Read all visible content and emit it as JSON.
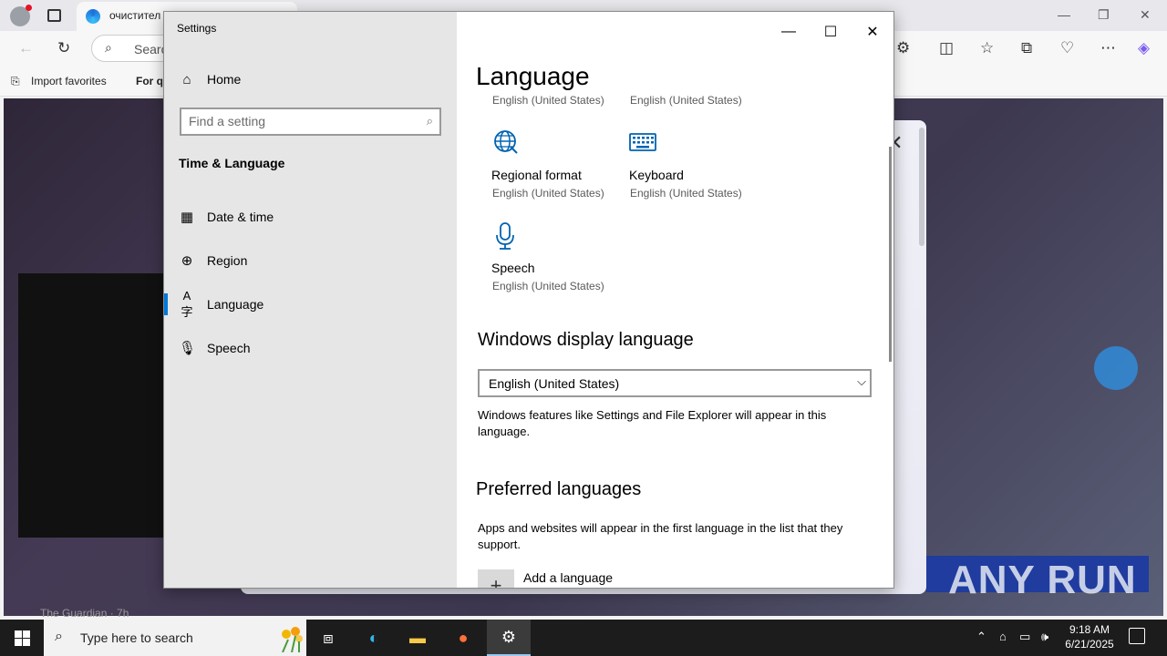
{
  "browser": {
    "tab_title": "очистител",
    "address_placeholder": "Searc",
    "favorites": [
      "Import favorites",
      "For qu"
    ],
    "page_footer": "The Guardian · 7h"
  },
  "settings": {
    "window_title": "Settings",
    "nav": {
      "home": "Home",
      "search_placeholder": "Find a setting",
      "section": "Time & Language",
      "items": [
        "Date & time",
        "Region",
        "Language",
        "Speech"
      ]
    },
    "content": {
      "title": "Language",
      "clipped_subs": [
        "English (United States)",
        "English (United States)"
      ],
      "tiles": [
        {
          "label": "Regional format",
          "sub": "English (United States)",
          "icon": "globe-icon"
        },
        {
          "label": "Keyboard",
          "sub": "English (United States)",
          "icon": "keyboard-icon"
        },
        {
          "label": "Speech",
          "sub": "English (United States)",
          "icon": "microphone-icon"
        }
      ],
      "display_language": {
        "heading": "Windows display language",
        "selected": "English (United States)",
        "description": "Windows features like Settings and File Explorer will appear in this language."
      },
      "preferred": {
        "heading": "Preferred languages",
        "description": "Apps and websites will appear in the first language in the list that they support.",
        "add_label": "Add a language"
      }
    }
  },
  "taskbar": {
    "search_placeholder": "Type here to search",
    "time": "9:18 AM",
    "date": "6/21/2025"
  },
  "watermark": "ANY RUN",
  "colors": {
    "accent": "#0078d7",
    "icon_blue": "#0063b1",
    "nav_bg": "#e6e6e6",
    "taskbar": "#1c1c1c"
  }
}
